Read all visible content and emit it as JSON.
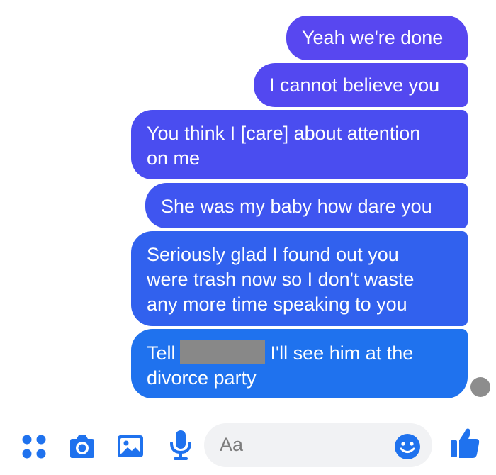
{
  "colors": {
    "accent": "#1f72ee",
    "bubble_gradient": [
      "#5847f0",
      "#5348f0",
      "#4a4df0",
      "#3f55f0",
      "#3161ee",
      "#1f72ee"
    ],
    "seen_indicator": "#8d8d8d",
    "input_background": "#f1f2f4"
  },
  "messages": [
    {
      "text": "Yeah we're done"
    },
    {
      "text": "I cannot believe you"
    },
    {
      "text": "You think I [care] about attention\non me"
    },
    {
      "text": "She was my baby how dare you"
    },
    {
      "text": "Seriously glad I found out you\nwere trash now so I don't waste\nany more time speaking to you"
    },
    {
      "text_before": "Tell",
      "text_after": "I'll see him at the\ndivorce party",
      "redacted": true
    }
  ],
  "composer": {
    "placeholder": "Aa",
    "icons": [
      "more-apps-icon",
      "camera-icon",
      "photo-icon",
      "microphone-icon",
      "emoji-icon",
      "thumbs-up-icon"
    ]
  }
}
